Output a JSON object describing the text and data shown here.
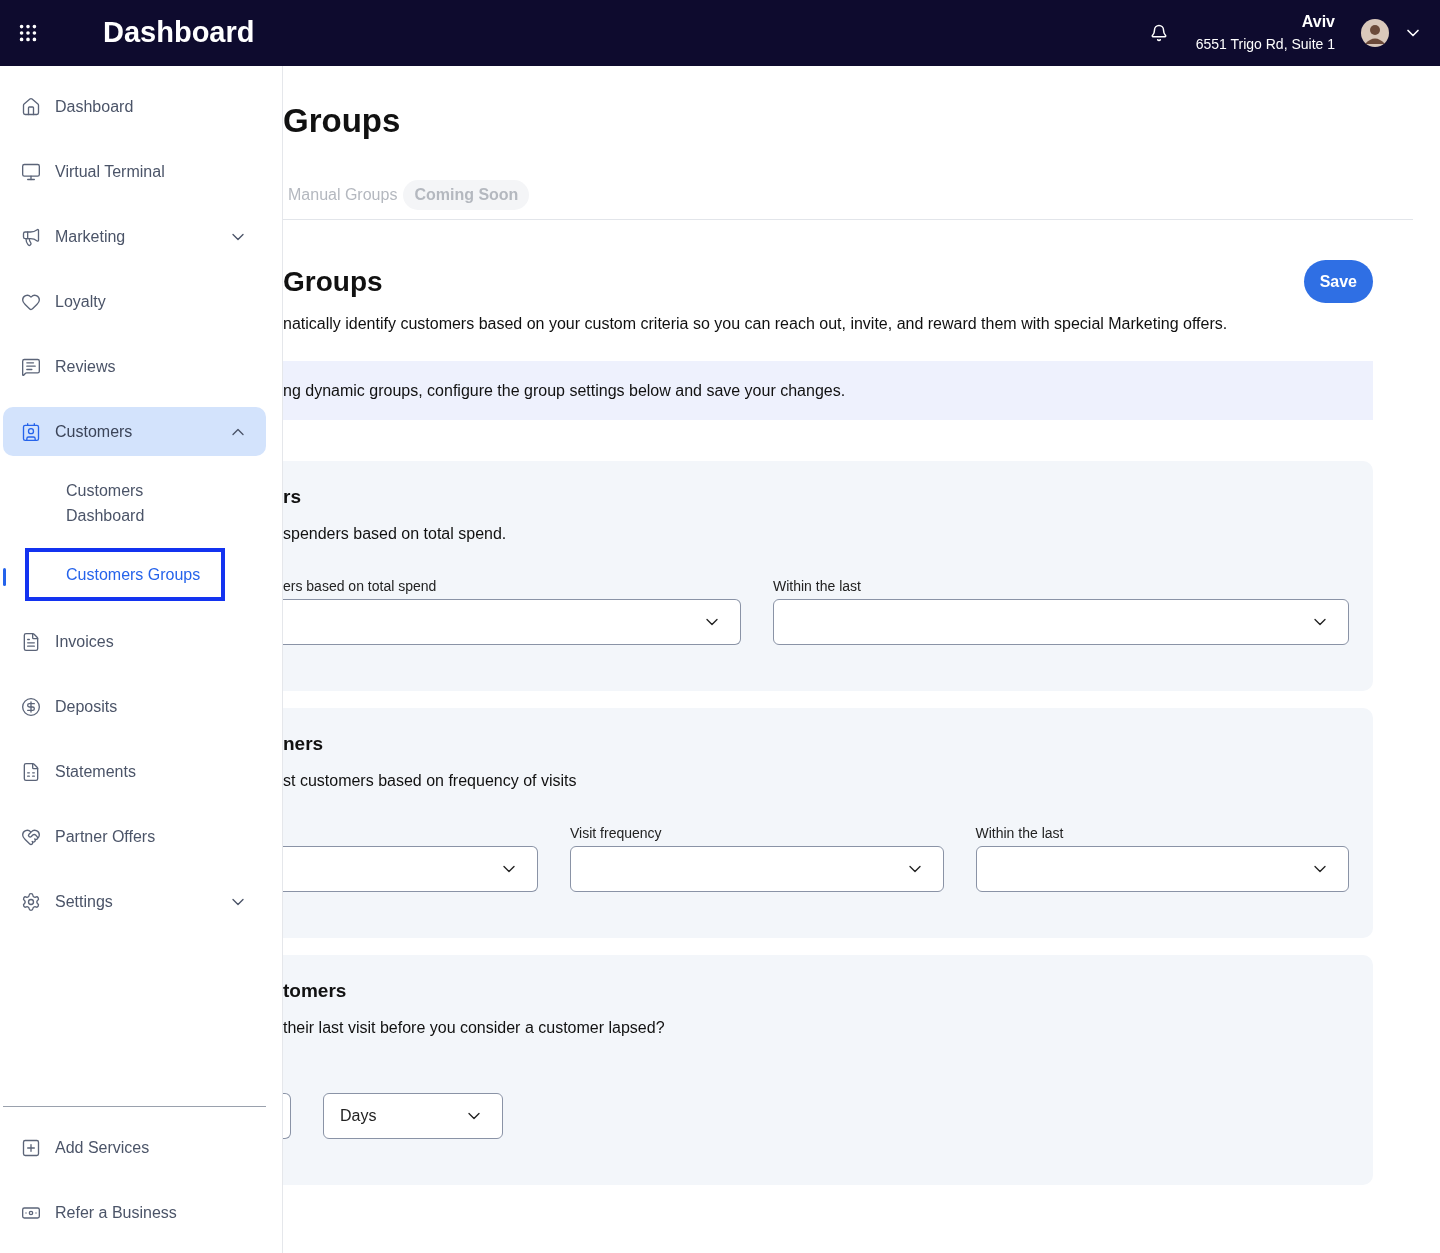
{
  "header": {
    "title": "Dashboard",
    "user_name": "Aviv",
    "address": "6551 Trigo Rd, Suite 1"
  },
  "sidebar": {
    "items": [
      {
        "kind": "home",
        "label": "Dashboard",
        "selected": false
      },
      {
        "kind": "terminal",
        "label": "Virtual Terminal",
        "selected": false
      },
      {
        "kind": "megaphone",
        "label": "Marketing",
        "selected": false,
        "expanded": false
      },
      {
        "kind": "heart",
        "label": "Loyalty",
        "selected": false
      },
      {
        "kind": "reviews",
        "label": "Reviews",
        "selected": false
      },
      {
        "kind": "customers",
        "label": "Customers",
        "selected": true,
        "expanded": true,
        "children": [
          {
            "label": "Customers Dashboard",
            "selected": false
          },
          {
            "label": "Customers Groups",
            "selected": true
          }
        ]
      },
      {
        "kind": "invoice",
        "label": "Invoices",
        "selected": false
      },
      {
        "kind": "deposit",
        "label": "Deposits",
        "selected": false
      },
      {
        "kind": "statement",
        "label": "Statements",
        "selected": false
      },
      {
        "kind": "handshake",
        "label": "Partner Offers",
        "selected": false
      },
      {
        "kind": "settings",
        "label": "Settings",
        "selected": false,
        "expanded": false
      }
    ],
    "footer_items": [
      {
        "kind": "add",
        "label": "Add Services"
      },
      {
        "kind": "cash",
        "label": "Refer a Business"
      }
    ]
  },
  "page": {
    "title": "Groups",
    "tabs": [
      {
        "label": "Manual Groups",
        "disabled": true,
        "badge": "Coming Soon"
      }
    ]
  },
  "section": {
    "title": "Groups",
    "save_button": "Save",
    "description": "natically identify customers based on your custom criteria so you can reach out, invite, and reward them with special Marketing offers.",
    "notice": "ng dynamic groups, configure the group settings below and save your changes."
  },
  "cards": [
    {
      "title": "rs",
      "description": "spenders based on total spend.",
      "fields": [
        {
          "kind": "select",
          "label": "ers based on total spend"
        },
        {
          "kind": "select",
          "label": "Within the last"
        }
      ]
    },
    {
      "title": "ners",
      "description": "st customers based on frequency of visits",
      "fields": [
        {
          "kind": "select"
        },
        {
          "kind": "select",
          "label": "Visit frequency"
        },
        {
          "kind": "select",
          "label": "Within the last"
        }
      ]
    },
    {
      "title": "tomers",
      "description": "their last visit before you consider a customer lapsed?",
      "fields": [
        {
          "kind": "stub"
        },
        {
          "kind": "select",
          "value": "Days"
        }
      ]
    }
  ]
}
